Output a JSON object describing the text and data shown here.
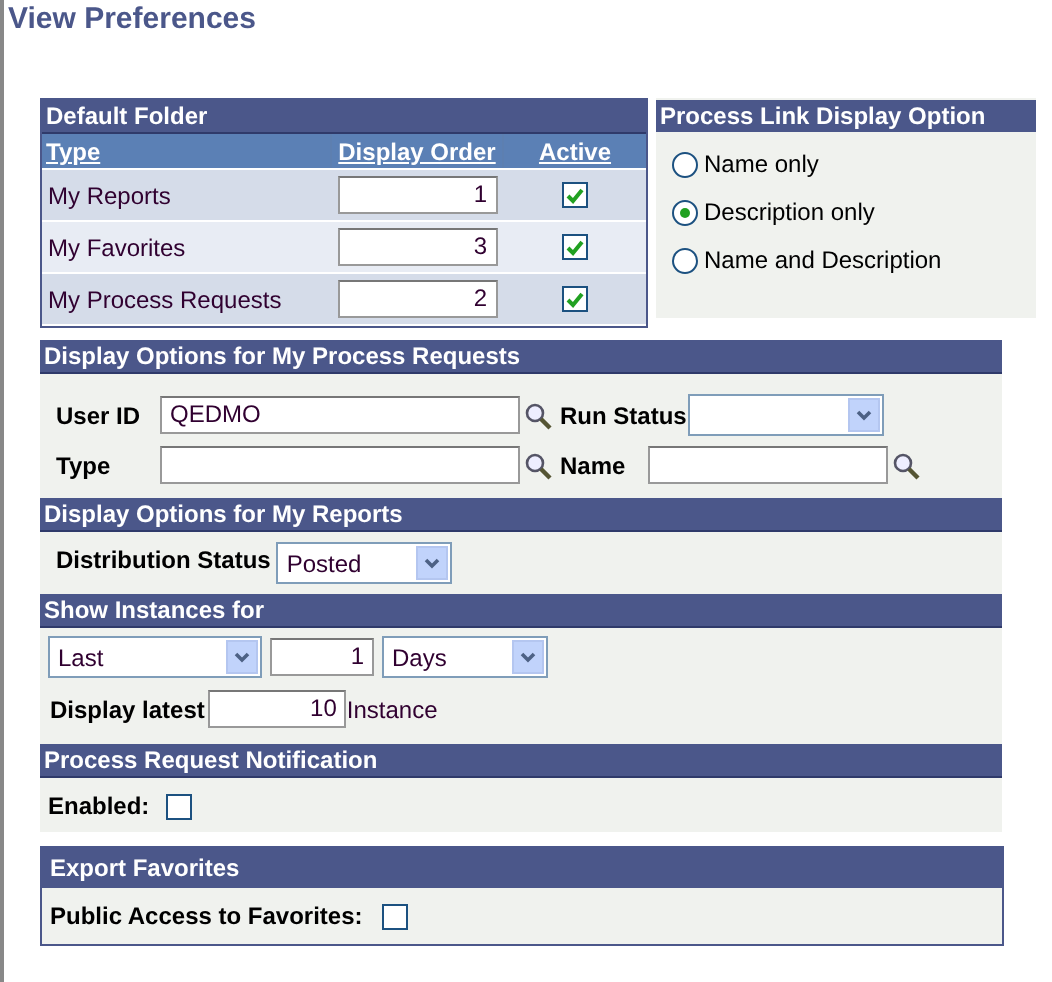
{
  "page_title": "View Preferences",
  "default_folder": {
    "title": "Default Folder",
    "columns": [
      "Type",
      "Display Order",
      "Active"
    ],
    "rows": [
      {
        "type": "My Reports",
        "order": "1",
        "active": true
      },
      {
        "type": "My Favorites",
        "order": "3",
        "active": true
      },
      {
        "type": "My Process Requests",
        "order": "2",
        "active": true
      }
    ]
  },
  "process_link": {
    "title": "Process Link Display Option",
    "options": [
      {
        "label": "Name only",
        "selected": false
      },
      {
        "label": "Description only",
        "selected": true
      },
      {
        "label": "Name and Description",
        "selected": false
      }
    ]
  },
  "process_requests": {
    "title": "Display Options for My Process Requests",
    "user_id_label": "User ID",
    "user_id": "QEDMO",
    "run_status_label": "Run Status",
    "type_label": "Type",
    "name_label": "Name"
  },
  "reports": {
    "title": "Display Options for My Reports",
    "distribution_label": "Distribution Status",
    "distribution": "Posted"
  },
  "instances": {
    "title": "Show Instances for",
    "range": "Last",
    "count": "1",
    "unit": "Days",
    "latest_label": "Display latest",
    "latest": "10",
    "latest_suffix": "Instance"
  },
  "notification": {
    "title": "Process Request Notification",
    "enabled_label": "Enabled:",
    "enabled": false
  },
  "export": {
    "title": "Export Favorites",
    "public_label": "Public Access to Favorites:",
    "public": false
  }
}
